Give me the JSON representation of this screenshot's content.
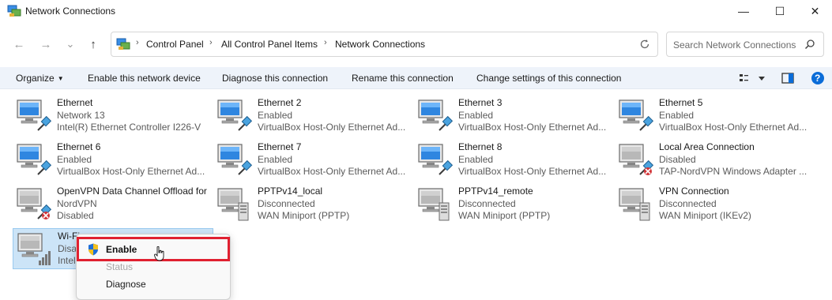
{
  "window": {
    "title": "Network Connections",
    "controls": {
      "minimize": "—",
      "maximize": "☐",
      "close": "✕"
    }
  },
  "nav": {
    "back": "←",
    "forward": "→",
    "recent": "⌄",
    "up": "↑"
  },
  "breadcrumb": {
    "items": [
      "Control Panel",
      "All Control Panel Items",
      "Network Connections"
    ],
    "separator": "›"
  },
  "search": {
    "placeholder": "Search Network Connections"
  },
  "commandbar": {
    "organize": "Organize",
    "enable_device": "Enable this network device",
    "diagnose": "Diagnose this connection",
    "rename": "Rename this connection",
    "change_settings": "Change settings of this connection",
    "help": "?"
  },
  "connections": [
    {
      "name": "Ethernet",
      "status": "Network 13",
      "device": "Intel(R) Ethernet Controller I226-V",
      "type": "ethernet",
      "state": "connected"
    },
    {
      "name": "Ethernet 2",
      "status": "Enabled",
      "device": "VirtualBox Host-Only Ethernet Ad...",
      "type": "ethernet",
      "state": "enabled"
    },
    {
      "name": "Ethernet 3",
      "status": "Enabled",
      "device": "VirtualBox Host-Only Ethernet Ad...",
      "type": "ethernet",
      "state": "enabled"
    },
    {
      "name": "Ethernet 5",
      "status": "Enabled",
      "device": "VirtualBox Host-Only Ethernet Ad...",
      "type": "ethernet",
      "state": "enabled"
    },
    {
      "name": "Ethernet 6",
      "status": "Enabled",
      "device": "VirtualBox Host-Only Ethernet Ad...",
      "type": "ethernet",
      "state": "enabled"
    },
    {
      "name": "Ethernet 7",
      "status": "Enabled",
      "device": "VirtualBox Host-Only Ethernet Ad...",
      "type": "ethernet",
      "state": "enabled"
    },
    {
      "name": "Ethernet 8",
      "status": "Enabled",
      "device": "VirtualBox Host-Only Ethernet Ad...",
      "type": "ethernet",
      "state": "enabled"
    },
    {
      "name": "Local Area Connection",
      "status": "Disabled",
      "device": "TAP-NordVPN Windows Adapter ...",
      "type": "ethernet",
      "state": "disabled"
    },
    {
      "name": "OpenVPN Data Channel Offload for",
      "status": "NordVPN",
      "device": "Disabled",
      "type": "ethernet",
      "state": "disabled"
    },
    {
      "name": "PPTPv14_local",
      "status": "Disconnected",
      "device": "WAN Miniport (PPTP)",
      "type": "vpn",
      "state": "disconnected"
    },
    {
      "name": "PPTPv14_remote",
      "status": "Disconnected",
      "device": "WAN Miniport (PPTP)",
      "type": "vpn",
      "state": "disconnected"
    },
    {
      "name": "VPN Connection",
      "status": "Disconnected",
      "device": "WAN Miniport (IKEv2)",
      "type": "vpn",
      "state": "disconnected"
    },
    {
      "name": "Wi-Fi",
      "status": "Disa",
      "device": "Intel",
      "type": "wifi",
      "state": "disabled"
    }
  ],
  "context_menu": {
    "items": [
      {
        "label": "Enable",
        "state": "hover",
        "icon": "uac-shield-icon"
      },
      {
        "label": "Status",
        "state": "disabled"
      },
      {
        "label": "Diagnose",
        "state": "normal"
      }
    ]
  },
  "colors": {
    "accent": "#0067c0",
    "selection": "#cce4f7",
    "highlight_box": "#e02030",
    "commandbar_bg": "#eef3fa",
    "help_badge": "#0a6cd8"
  }
}
